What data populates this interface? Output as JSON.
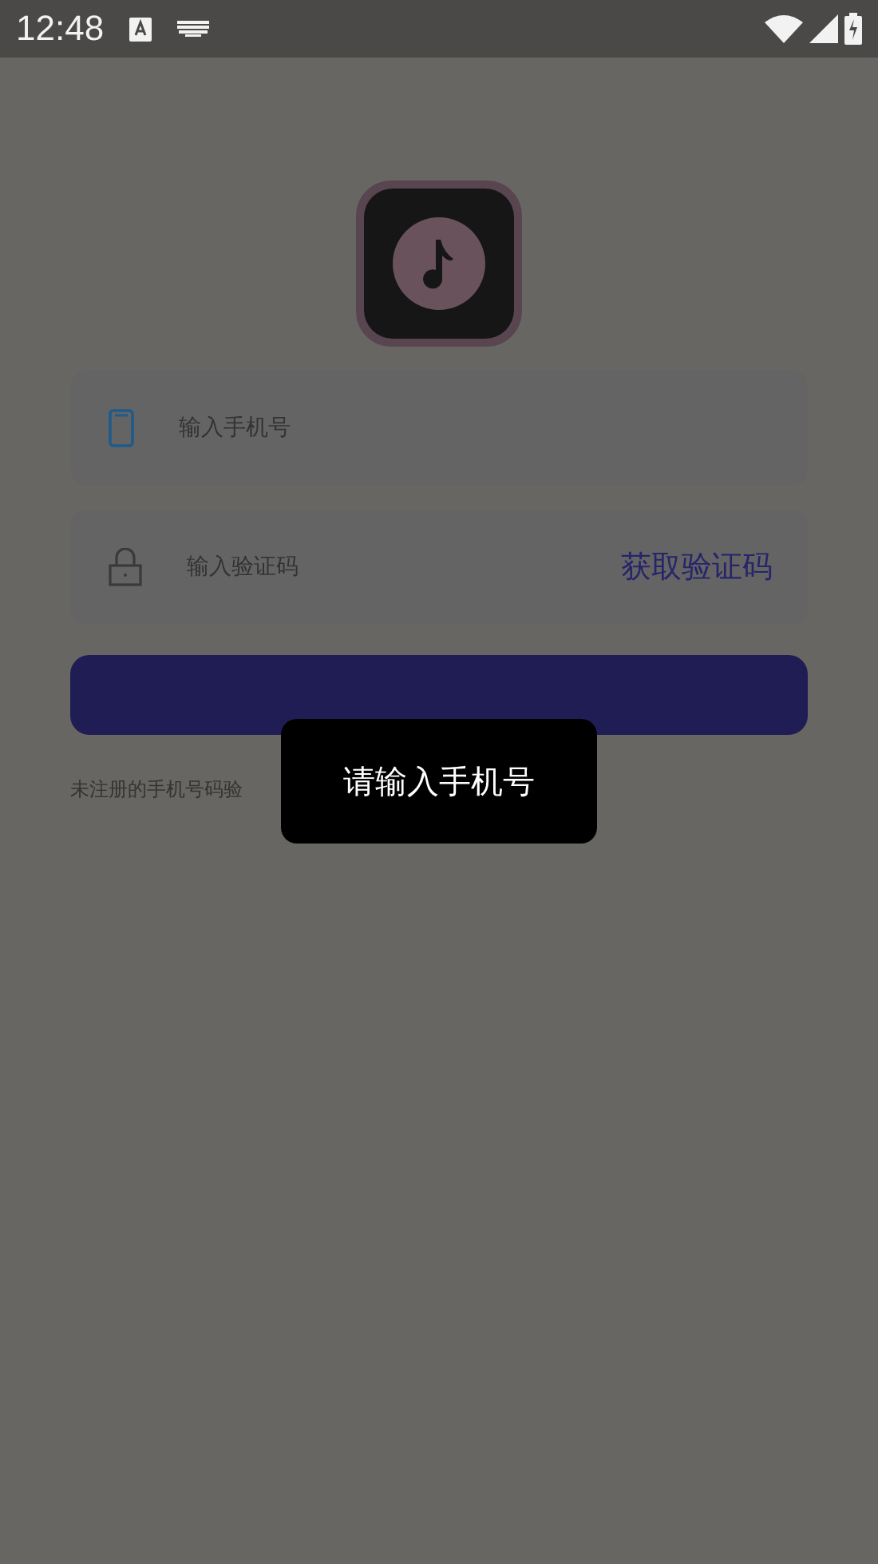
{
  "status_bar": {
    "time": "12:48"
  },
  "fields": [
    {
      "kind": "phone",
      "placeholder": "输入手机号"
    },
    {
      "kind": "code",
      "placeholder": "输入验证码",
      "action": "获取验证码"
    }
  ],
  "hint": "未注册的手机号码验",
  "toast": "请输入手机号"
}
